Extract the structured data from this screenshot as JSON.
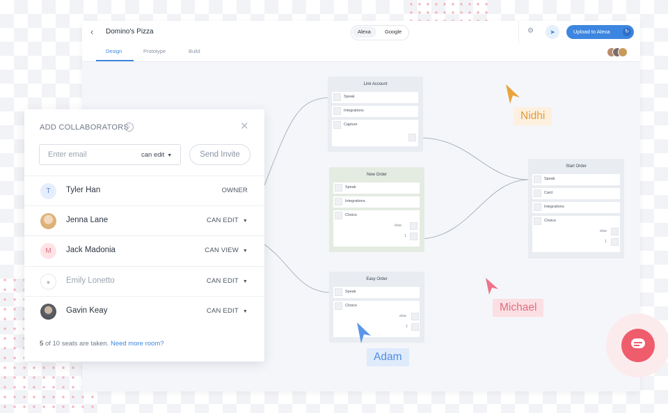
{
  "header": {
    "back_icon": "chevron-left-icon",
    "project_title": "Domino's Pizza",
    "platforms": [
      "Alexa",
      "Google"
    ],
    "selected_platform": "Alexa",
    "settings_icon": "gear-icon",
    "share_icon": "share-icon",
    "upload_label": "Upload to Alexa",
    "sync_icon": "sync-icon"
  },
  "tabs": [
    {
      "label": "Design",
      "active": true
    },
    {
      "label": "Prototype",
      "active": false
    },
    {
      "label": "Build",
      "active": false
    }
  ],
  "canvas": {
    "blocks": [
      {
        "title": "Link Account",
        "steps": [
          "Speak",
          "Integrations",
          "Capture"
        ]
      },
      {
        "title": "New Order",
        "steps": [
          "Speak",
          "Integrations",
          "Choice"
        ],
        "ports": [
          "else",
          "1"
        ]
      },
      {
        "title": "Easy Order",
        "steps": [
          "Speak",
          "Choice"
        ],
        "ports": [
          "else",
          "1"
        ]
      },
      {
        "title": "Start Order",
        "steps": [
          "Speak",
          "Card",
          "Integrations",
          "Choice"
        ],
        "ports": [
          "else",
          "1"
        ]
      }
    ],
    "cursors": [
      {
        "name": "Nidhi",
        "color": "#e49a36"
      },
      {
        "name": "Michael",
        "color": "#e06e80"
      },
      {
        "name": "Adam",
        "color": "#4d8ee3"
      }
    ]
  },
  "modal": {
    "title": "ADD COLLABORATORS",
    "info_icon": "info-icon",
    "close_icon": "close-icon",
    "email_placeholder": "Enter email",
    "permission": "can edit",
    "send_label": "Send Invite",
    "members": [
      {
        "initial": "T",
        "name": "Tyler Han",
        "role": "OWNER",
        "avatar_color": "#e6eefc",
        "initial_color": "#5b86d6"
      },
      {
        "initial": "",
        "name": "Jenna Lane",
        "role": "CAN EDIT",
        "avatar_color": "#e8b98f"
      },
      {
        "initial": "M",
        "name": "Jack Madonia",
        "role": "CAN VIEW",
        "avatar_color": "#fde3e6",
        "initial_color": "#e06e80"
      },
      {
        "initial": "",
        "name": "Emily Lonetto",
        "role": "CAN EDIT",
        "pending": true,
        "avatar_color": "#ffffff"
      },
      {
        "initial": "",
        "name": "Gavin Keay",
        "role": "CAN EDIT",
        "avatar_color": "#6c6f73"
      }
    ],
    "seats_used": "5",
    "seats_text": "of 10 seats are taken.",
    "more_link": "Need more room?"
  },
  "chat_icon": "chat-bubble-icon",
  "colors": {
    "accent": "#3d86e0",
    "chat": "#ef5d6d"
  }
}
